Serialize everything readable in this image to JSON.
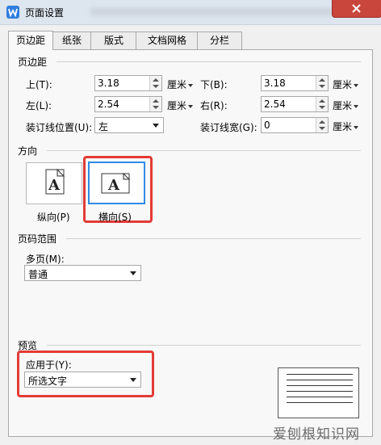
{
  "window": {
    "title": "页面设置"
  },
  "tabs": [
    {
      "label": "页边距",
      "active": true
    },
    {
      "label": "纸张",
      "active": false
    },
    {
      "label": "版式",
      "active": false
    },
    {
      "label": "文档网格",
      "active": false
    },
    {
      "label": "分栏",
      "active": false
    }
  ],
  "margins": {
    "section": "页边距",
    "top_label": "上(T):",
    "top_value": "3.18",
    "bottom_label": "下(B):",
    "bottom_value": "3.18",
    "left_label": "左(L):",
    "left_value": "2.54",
    "right_label": "右(R):",
    "right_value": "2.54",
    "gutter_pos_label": "装订线位置(U):",
    "gutter_pos_value": "左",
    "gutter_width_label": "装订线宽(G):",
    "gutter_width_value": "0",
    "unit": "厘米"
  },
  "orientation": {
    "section": "方向",
    "portrait_label": "纵向(P)",
    "landscape_label": "横向(S)",
    "glyph": "A",
    "selected": "landscape"
  },
  "page_range": {
    "section": "页码范围",
    "multi_label": "多页(M):",
    "multi_value": "普通"
  },
  "preview": {
    "section": "预览",
    "apply_label": "应用于(Y):",
    "apply_value": "所选文字"
  },
  "watermark": "爱刨根知识网",
  "colors": {
    "highlight": "#e33b36",
    "selected_border": "#2f8be6",
    "close": "#c9463d"
  }
}
